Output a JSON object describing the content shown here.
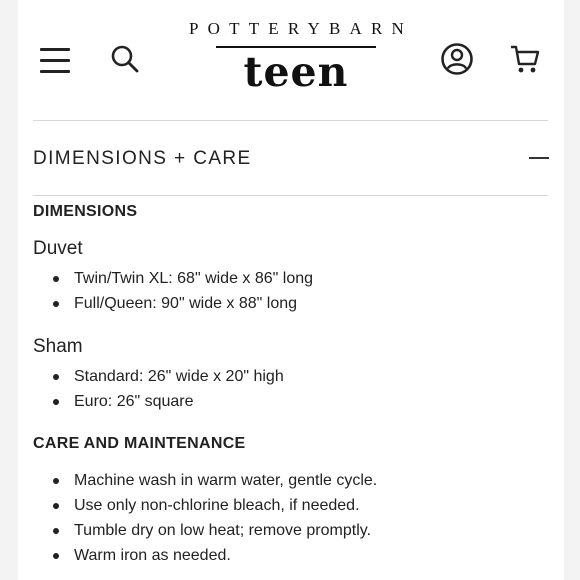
{
  "header": {
    "brand_top": "POTTERYBARN",
    "brand_bottom": "teen",
    "icons": {
      "menu": "hamburger-menu-icon",
      "search": "search-icon",
      "account": "account-icon",
      "cart": "cart-icon"
    }
  },
  "section": {
    "title": "DIMENSIONS + CARE",
    "toggle_icon": "minus-icon"
  },
  "dimensions": {
    "heading": "DIMENSIONS",
    "groups": [
      {
        "title": "Duvet",
        "items": [
          "Twin/Twin XL: 68\" wide x 86\" long",
          "Full/Queen: 90\" wide x 88\" long"
        ]
      },
      {
        "title": "Sham",
        "items": [
          "Standard: 26\" wide x 20\" high",
          "Euro: 26\" square"
        ]
      }
    ]
  },
  "care": {
    "heading": "CARE AND MAINTENANCE",
    "items": [
      "Machine wash in warm water, gentle cycle.",
      "Use only non-chlorine bleach, if needed.",
      "Tumble dry on low heat; remove promptly.",
      "Warm iron as needed."
    ]
  }
}
